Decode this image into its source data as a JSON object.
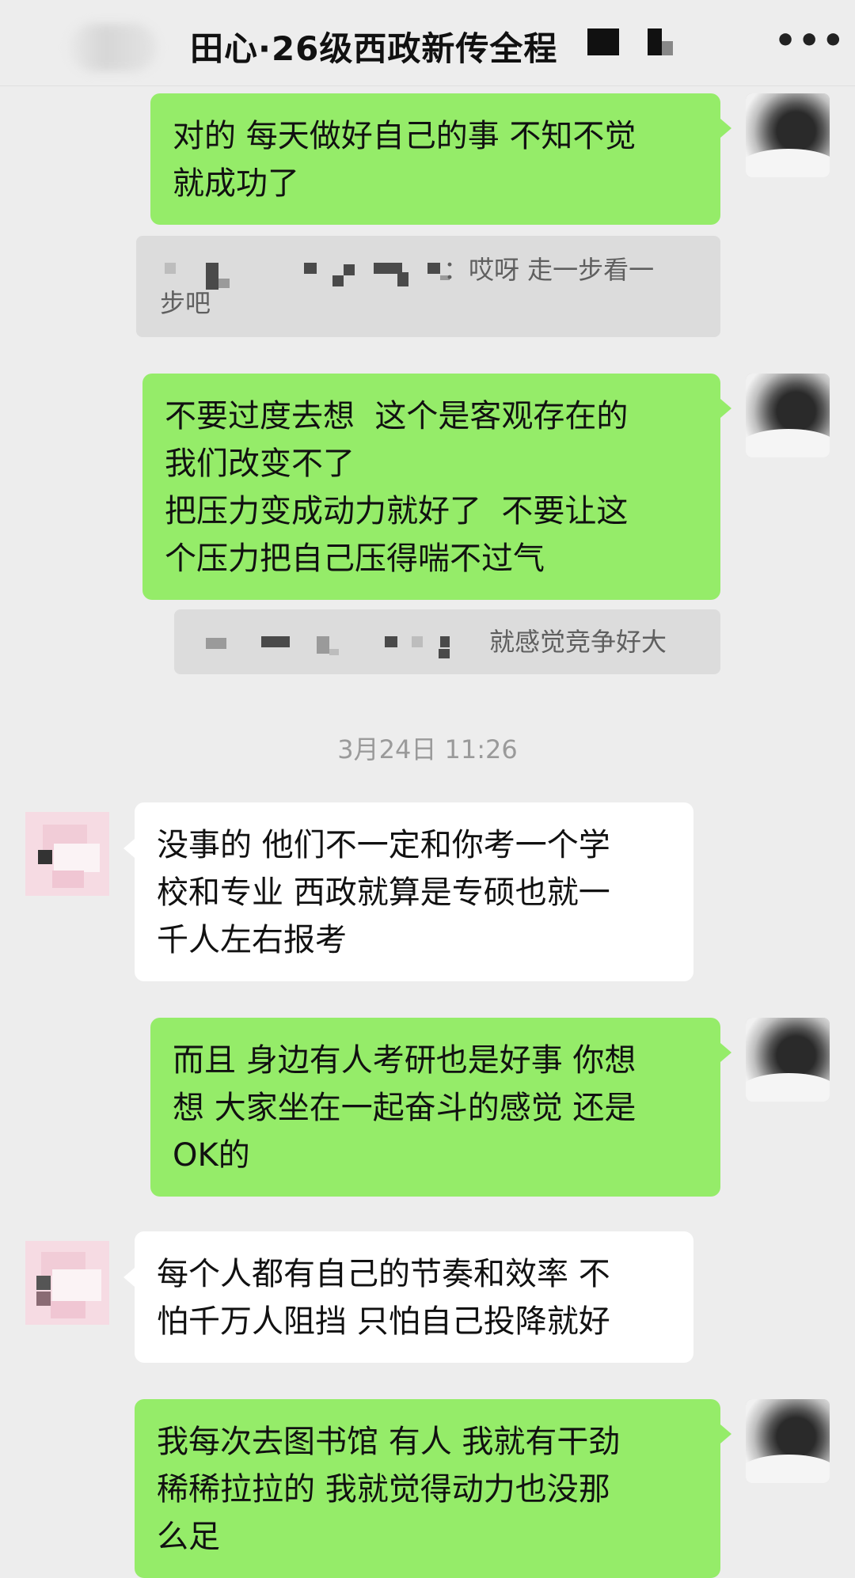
{
  "header": {
    "title": "田心·26级西政新传全程",
    "more_icon": "more-icon"
  },
  "messages": [
    {
      "from": "me",
      "lines": [
        "对的 每天做好自己的事 不知不觉",
        "就成功了"
      ]
    },
    {
      "from": "quote",
      "text_line1": "：哎呀 走一步看一",
      "text_line2": "步吧"
    },
    {
      "from": "me",
      "lines": [
        "不要过度去想  这个是客观存在的",
        "我们改变不了",
        "把压力变成动力就好了  不要让这",
        "个压力把自己压得喘不过气"
      ]
    },
    {
      "from": "quote",
      "text": "就感觉竞争好大"
    },
    {
      "from": "other",
      "lines": [
        "没事的 他们不一定和你考一个学",
        "校和专业 西政就算是专硕也就一",
        "千人左右报考"
      ]
    },
    {
      "from": "me",
      "lines": [
        "而且 身边有人考研也是好事 你想",
        "想 大家坐在一起奋斗的感觉 还是",
        "OK的"
      ]
    },
    {
      "from": "other",
      "lines": [
        "每个人都有自己的节奏和效率 不",
        "怕千万人阻挡 只怕自己投降就好"
      ]
    },
    {
      "from": "me",
      "lines": [
        "我每次去图书馆 有人 我就有干劲",
        "稀稀拉拉的 我就觉得动力也没那",
        "么足"
      ]
    }
  ],
  "timestamp": "3月24日 11:26",
  "colors": {
    "background": "#ededed",
    "my_bubble": "#95ec69",
    "other_bubble": "#ffffff",
    "quote_bg": "#dcdcdc"
  }
}
